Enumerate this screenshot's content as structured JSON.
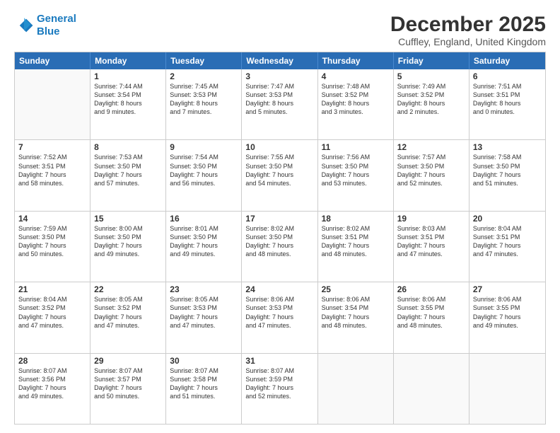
{
  "logo": {
    "line1": "General",
    "line2": "Blue"
  },
  "title": "December 2025",
  "location": "Cuffley, England, United Kingdom",
  "days_header": [
    "Sunday",
    "Monday",
    "Tuesday",
    "Wednesday",
    "Thursday",
    "Friday",
    "Saturday"
  ],
  "weeks": [
    [
      {
        "day": "",
        "info": ""
      },
      {
        "day": "1",
        "info": "Sunrise: 7:44 AM\nSunset: 3:54 PM\nDaylight: 8 hours\nand 9 minutes."
      },
      {
        "day": "2",
        "info": "Sunrise: 7:45 AM\nSunset: 3:53 PM\nDaylight: 8 hours\nand 7 minutes."
      },
      {
        "day": "3",
        "info": "Sunrise: 7:47 AM\nSunset: 3:53 PM\nDaylight: 8 hours\nand 5 minutes."
      },
      {
        "day": "4",
        "info": "Sunrise: 7:48 AM\nSunset: 3:52 PM\nDaylight: 8 hours\nand 3 minutes."
      },
      {
        "day": "5",
        "info": "Sunrise: 7:49 AM\nSunset: 3:52 PM\nDaylight: 8 hours\nand 2 minutes."
      },
      {
        "day": "6",
        "info": "Sunrise: 7:51 AM\nSunset: 3:51 PM\nDaylight: 8 hours\nand 0 minutes."
      }
    ],
    [
      {
        "day": "7",
        "info": "Sunrise: 7:52 AM\nSunset: 3:51 PM\nDaylight: 7 hours\nand 58 minutes."
      },
      {
        "day": "8",
        "info": "Sunrise: 7:53 AM\nSunset: 3:50 PM\nDaylight: 7 hours\nand 57 minutes."
      },
      {
        "day": "9",
        "info": "Sunrise: 7:54 AM\nSunset: 3:50 PM\nDaylight: 7 hours\nand 56 minutes."
      },
      {
        "day": "10",
        "info": "Sunrise: 7:55 AM\nSunset: 3:50 PM\nDaylight: 7 hours\nand 54 minutes."
      },
      {
        "day": "11",
        "info": "Sunrise: 7:56 AM\nSunset: 3:50 PM\nDaylight: 7 hours\nand 53 minutes."
      },
      {
        "day": "12",
        "info": "Sunrise: 7:57 AM\nSunset: 3:50 PM\nDaylight: 7 hours\nand 52 minutes."
      },
      {
        "day": "13",
        "info": "Sunrise: 7:58 AM\nSunset: 3:50 PM\nDaylight: 7 hours\nand 51 minutes."
      }
    ],
    [
      {
        "day": "14",
        "info": "Sunrise: 7:59 AM\nSunset: 3:50 PM\nDaylight: 7 hours\nand 50 minutes."
      },
      {
        "day": "15",
        "info": "Sunrise: 8:00 AM\nSunset: 3:50 PM\nDaylight: 7 hours\nand 49 minutes."
      },
      {
        "day": "16",
        "info": "Sunrise: 8:01 AM\nSunset: 3:50 PM\nDaylight: 7 hours\nand 49 minutes."
      },
      {
        "day": "17",
        "info": "Sunrise: 8:02 AM\nSunset: 3:50 PM\nDaylight: 7 hours\nand 48 minutes."
      },
      {
        "day": "18",
        "info": "Sunrise: 8:02 AM\nSunset: 3:51 PM\nDaylight: 7 hours\nand 48 minutes."
      },
      {
        "day": "19",
        "info": "Sunrise: 8:03 AM\nSunset: 3:51 PM\nDaylight: 7 hours\nand 47 minutes."
      },
      {
        "day": "20",
        "info": "Sunrise: 8:04 AM\nSunset: 3:51 PM\nDaylight: 7 hours\nand 47 minutes."
      }
    ],
    [
      {
        "day": "21",
        "info": "Sunrise: 8:04 AM\nSunset: 3:52 PM\nDaylight: 7 hours\nand 47 minutes."
      },
      {
        "day": "22",
        "info": "Sunrise: 8:05 AM\nSunset: 3:52 PM\nDaylight: 7 hours\nand 47 minutes."
      },
      {
        "day": "23",
        "info": "Sunrise: 8:05 AM\nSunset: 3:53 PM\nDaylight: 7 hours\nand 47 minutes."
      },
      {
        "day": "24",
        "info": "Sunrise: 8:06 AM\nSunset: 3:53 PM\nDaylight: 7 hours\nand 47 minutes."
      },
      {
        "day": "25",
        "info": "Sunrise: 8:06 AM\nSunset: 3:54 PM\nDaylight: 7 hours\nand 48 minutes."
      },
      {
        "day": "26",
        "info": "Sunrise: 8:06 AM\nSunset: 3:55 PM\nDaylight: 7 hours\nand 48 minutes."
      },
      {
        "day": "27",
        "info": "Sunrise: 8:06 AM\nSunset: 3:55 PM\nDaylight: 7 hours\nand 49 minutes."
      }
    ],
    [
      {
        "day": "28",
        "info": "Sunrise: 8:07 AM\nSunset: 3:56 PM\nDaylight: 7 hours\nand 49 minutes."
      },
      {
        "day": "29",
        "info": "Sunrise: 8:07 AM\nSunset: 3:57 PM\nDaylight: 7 hours\nand 50 minutes."
      },
      {
        "day": "30",
        "info": "Sunrise: 8:07 AM\nSunset: 3:58 PM\nDaylight: 7 hours\nand 51 minutes."
      },
      {
        "day": "31",
        "info": "Sunrise: 8:07 AM\nSunset: 3:59 PM\nDaylight: 7 hours\nand 52 minutes."
      },
      {
        "day": "",
        "info": ""
      },
      {
        "day": "",
        "info": ""
      },
      {
        "day": "",
        "info": ""
      }
    ]
  ]
}
